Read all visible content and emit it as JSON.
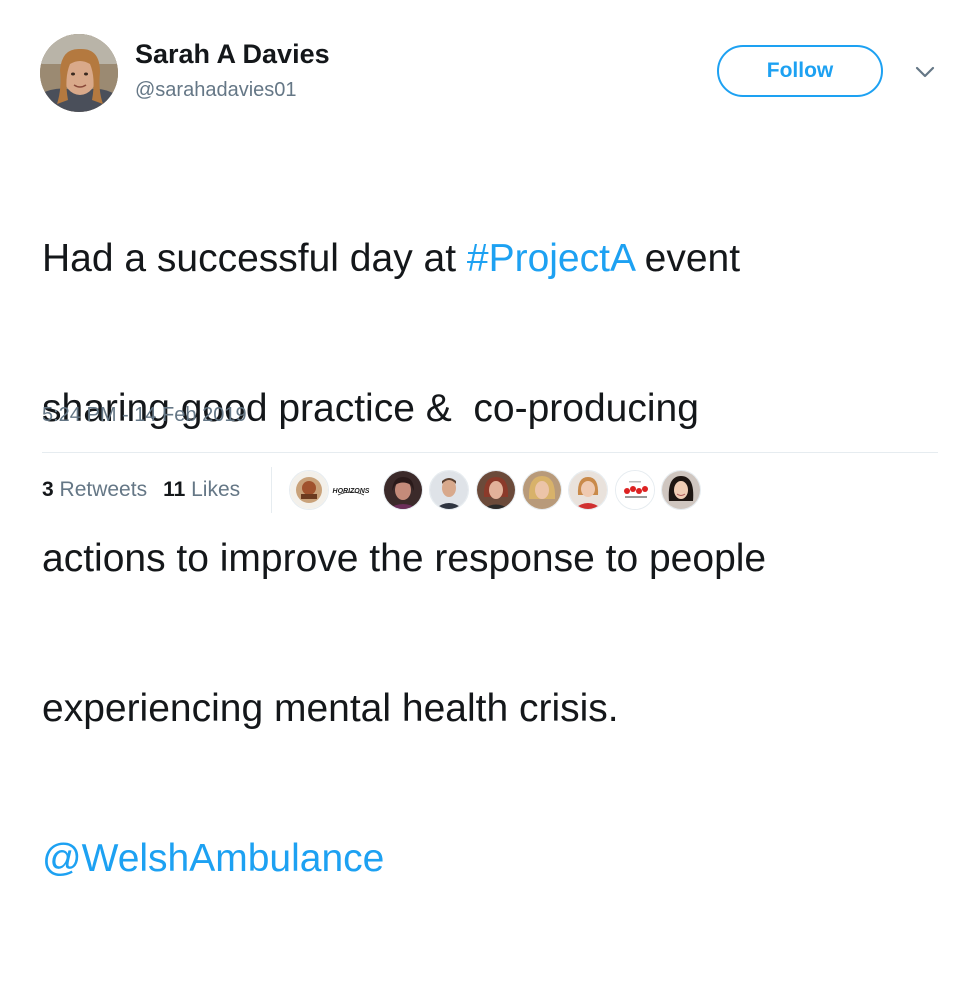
{
  "author": {
    "name": "Sarah A Davies",
    "handle": "@sarahadavies01"
  },
  "header": {
    "follow_label": "Follow",
    "menu_icon": "chevron-down-icon"
  },
  "tweet": {
    "line1_before": "Had a successful day at ",
    "hashtag": "#ProjectA",
    "line1_after": " event",
    "line2": "sharing good practice &  co-producing",
    "line3": "actions to improve the response to people",
    "line4": "experiencing mental health crisis.",
    "mention": "@WelshAmbulance"
  },
  "timestamp": "5:24 PM - 14 Feb 2019",
  "stats": {
    "retweets_count": "3",
    "retweets_label": "Retweets",
    "likes_count": "11",
    "likes_label": "Likes"
  },
  "likers": {
    "horizons_logo_text": "HORIZONS"
  },
  "colors": {
    "accent": "#1da1f2",
    "secondary_text": "#657786",
    "primary_text": "#14171a",
    "divider": "#e6ecf0"
  }
}
